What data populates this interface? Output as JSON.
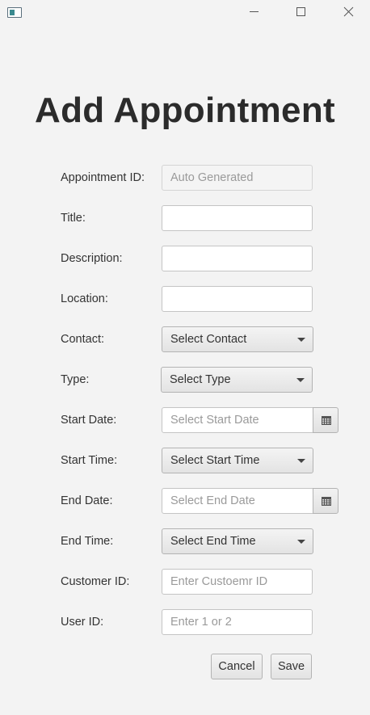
{
  "window": {
    "icons": {
      "app": "app-window-icon",
      "minimize": "minimize-icon",
      "maximize": "maximize-icon",
      "close": "close-icon"
    }
  },
  "heading": "Add Appointment",
  "form": {
    "appointment_id": {
      "label": "Appointment ID:",
      "value": "Auto Generated"
    },
    "title": {
      "label": "Title:",
      "value": ""
    },
    "description": {
      "label": "Description:",
      "value": ""
    },
    "location": {
      "label": "Location:",
      "value": ""
    },
    "contact": {
      "label": "Contact:",
      "selected": "Select Contact"
    },
    "type": {
      "label": "Type:",
      "selected": "Select Type"
    },
    "start_date": {
      "label": "Start Date:",
      "placeholder": "Select Start Date"
    },
    "start_time": {
      "label": "Start Time:",
      "selected": "Select Start Time"
    },
    "end_date": {
      "label": "End Date:",
      "placeholder": "Select End Date"
    },
    "end_time": {
      "label": "End Time:",
      "selected": "Select End Time"
    },
    "customer_id": {
      "label": "Customer ID:",
      "placeholder": "Enter Custoemr ID"
    },
    "user_id": {
      "label": "User ID:",
      "placeholder": "Enter 1 or 2"
    }
  },
  "buttons": {
    "cancel": "Cancel",
    "save": "Save"
  },
  "icons": {
    "dropdown": "chevron-down-icon",
    "calendar": "calendar-icon"
  }
}
